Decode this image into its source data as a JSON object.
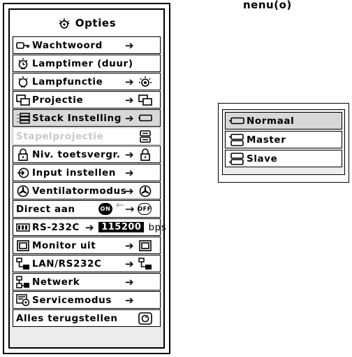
{
  "fragment_text": "nenu(o)",
  "panel": {
    "title": "Opties",
    "title_icon": "options-gear-icon"
  },
  "menu": {
    "items": [
      {
        "label": "Wachtwoord",
        "icon": "key-icon",
        "arrow": "➔"
      },
      {
        "label": "Lamptimer (duur)",
        "icon": "lamp-icon"
      },
      {
        "label": "Lampfunctie",
        "icon": "lamp-icon",
        "arrow": "➔",
        "right_icon": "lamp-mode-icon"
      },
      {
        "label": "Projectie",
        "icon": "projection-icon",
        "arrow": "➔",
        "right_icon": "projection-icon"
      },
      {
        "label": "Stack Instelling",
        "icon": "stack-icon",
        "arrow": "➔",
        "right_icon": "normal-mode-icon",
        "selected": true
      },
      {
        "label": "Stapelprojectie",
        "disabled": true,
        "right_icon": "stack-projection-icon"
      },
      {
        "label": "Niv. toetsvergr.",
        "icon": "padlock-icon",
        "arrow": "➔",
        "right_icon": "padlock-icon"
      },
      {
        "label": "Input instellen",
        "icon": "input-icon",
        "arrow": "➔"
      },
      {
        "label": "Ventilatormodus",
        "icon": "fan-icon",
        "arrow": "➔",
        "right_icon": "fan-icon"
      },
      {
        "label": "Direct aan",
        "on_label": "ON",
        "off_label": "OFF"
      },
      {
        "label": "RS-232C",
        "icon": "serial-port-icon",
        "arrow": "➔",
        "baud": "115200",
        "unit": "bps"
      },
      {
        "label": "Monitor uit",
        "icon": "monitor-icon",
        "arrow": "➔",
        "right_icon": "monitor-icon"
      },
      {
        "label": "LAN/RS232C",
        "icon": "network-icon",
        "arrow": "➔",
        "right_icon": "network-icon"
      },
      {
        "label": "Netwerk",
        "icon": "lan-icon",
        "arrow": "➔"
      },
      {
        "label": "Servicemodus",
        "icon": "service-icon",
        "arrow": "➔"
      },
      {
        "label": "Alles terugstellen",
        "right_icon": "reset-icon"
      }
    ]
  },
  "submenu": {
    "items": [
      {
        "label": "Normaal",
        "icon": "normal-mode-icon",
        "selected": true
      },
      {
        "label": "Master",
        "icon": "master-icon"
      },
      {
        "label": "Slave",
        "icon": "slave-icon"
      }
    ]
  },
  "colors": {
    "panel_background": "#ececec",
    "selected_row": "#d8d8d8",
    "disabled_text": "#c8c8c8"
  }
}
